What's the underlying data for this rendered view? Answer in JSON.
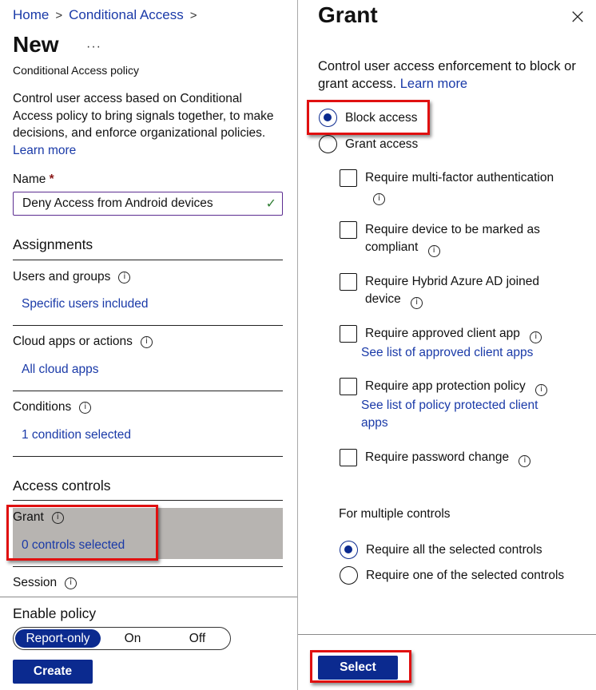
{
  "left": {
    "breadcrumb": [
      {
        "label": "Home"
      },
      {
        "label": "Conditional Access"
      }
    ],
    "breadcrumb_separator": ">",
    "title": "New",
    "more_label": "···",
    "subtitle": "Conditional Access policy",
    "description": "Control user access based on Conditional Access policy to bring signals together, to make decisions, and enforce organizational policies.",
    "learn_more": "Learn more",
    "name_label": "Name",
    "name_required": "*",
    "name_value": "Deny Access from Android devices",
    "assignments_heading": "Assignments",
    "users_label": "Users and groups",
    "users_value": "Specific users included",
    "cloud_label": "Cloud apps or actions",
    "cloud_value": "All cloud apps",
    "conditions_label": "Conditions",
    "conditions_value": "1 condition selected",
    "access_controls_heading": "Access controls",
    "grant_label": "Grant",
    "grant_value": "0 controls selected",
    "session_label": "Session",
    "enable_policy_label": "Enable policy",
    "enable_policy_options": [
      "Report-only",
      "On",
      "Off"
    ],
    "enable_policy_selected": "Report-only",
    "create_label": "Create"
  },
  "right": {
    "title": "Grant",
    "close_icon": "×",
    "description": "Control user access enforcement to block or grant access.",
    "learn_more": "Learn more",
    "access_options": [
      {
        "label": "Block access",
        "checked": true
      },
      {
        "label": "Grant access",
        "checked": false
      }
    ],
    "controls": [
      {
        "label": "Require multi-factor authentication",
        "checked": false
      },
      {
        "label": "Require device to be marked as compliant",
        "checked": false
      },
      {
        "label": "Require Hybrid Azure AD joined device",
        "checked": false
      },
      {
        "label": "Require approved client app",
        "checked": false,
        "link": "See list of approved client apps"
      },
      {
        "label": "Require app protection policy",
        "checked": false,
        "link": "See list of policy protected client apps"
      },
      {
        "label": "Require password change",
        "checked": false
      }
    ],
    "multiple_controls_label": "For multiple controls",
    "multiple_options": [
      {
        "label": "Require all the selected controls",
        "checked": true
      },
      {
        "label": "Require one of the selected controls",
        "checked": false
      }
    ],
    "select_label": "Select"
  },
  "colors": {
    "primary": "#0b2a8f",
    "link": "#1a3aa8",
    "highlight_bg": "#b7b4b1",
    "annotation_red": "#e01010",
    "valid_check": "#2e7d32"
  }
}
